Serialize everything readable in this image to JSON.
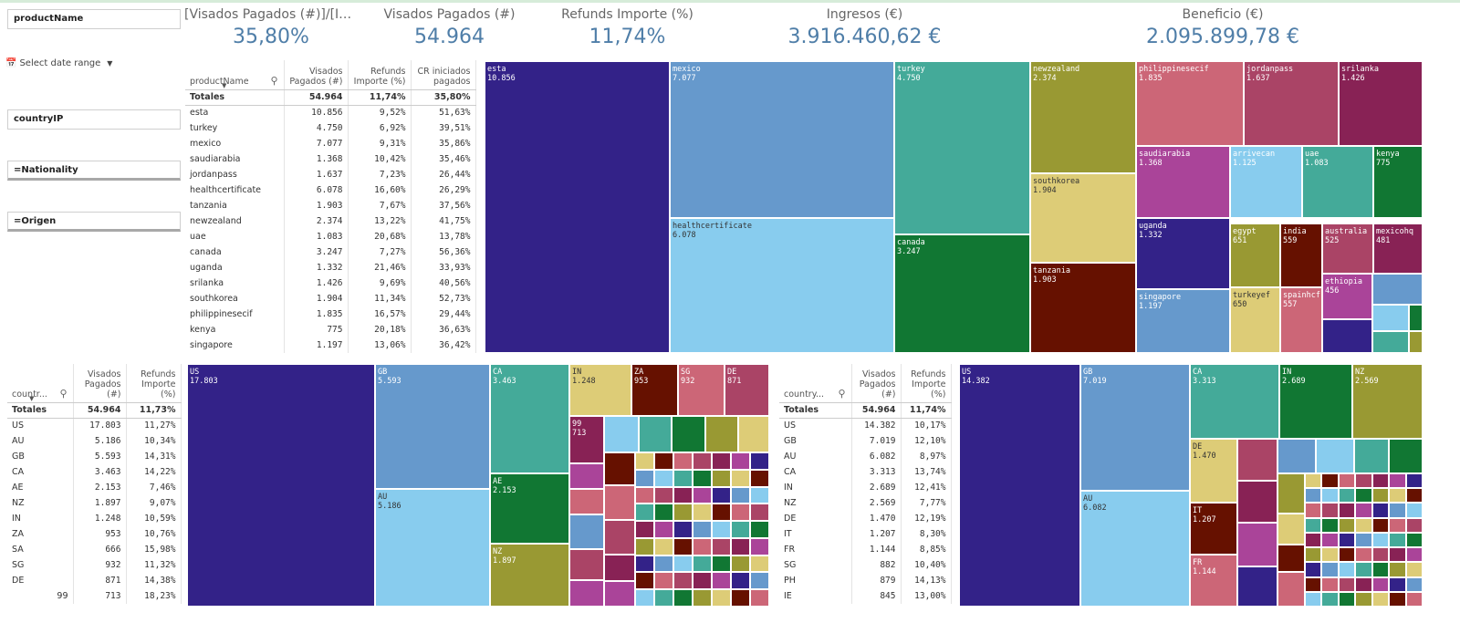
{
  "filters": {
    "product_name": "productName",
    "date_range": "Select date range",
    "country_ip": "countryIP",
    "nationality": "=Nationality",
    "origen": "=Origen"
  },
  "kpis": [
    {
      "label": "[Visados Pagados (#)]/[Iniciad...",
      "value": "35,80%"
    },
    {
      "label": "Visados Pagados (#)",
      "value": "54.964"
    },
    {
      "label": "Refunds Importe (%)",
      "value": "11,74%"
    },
    {
      "label": "Ingresos (€)",
      "value": "3.916.460,62 €"
    },
    {
      "label": "Beneficio (€)",
      "value": "2.095.899,78 €"
    }
  ],
  "product_table": {
    "headers": [
      "productName",
      "Visados Pagados (#)",
      "Refunds Importe (%)",
      "CR iniciados pagados"
    ],
    "totals": [
      "Totales",
      "54.964",
      "11,74%",
      "35,80%"
    ],
    "rows": [
      [
        "esta",
        "10.856",
        "9,52%",
        "51,63%"
      ],
      [
        "turkey",
        "4.750",
        "6,92%",
        "39,51%"
      ],
      [
        "mexico",
        "7.077",
        "9,31%",
        "35,86%"
      ],
      [
        "saudiarabia",
        "1.368",
        "10,42%",
        "35,46%"
      ],
      [
        "jordanpass",
        "1.637",
        "7,23%",
        "26,44%"
      ],
      [
        "healthcertificate",
        "6.078",
        "16,60%",
        "26,29%"
      ],
      [
        "tanzania",
        "1.903",
        "7,67%",
        "37,56%"
      ],
      [
        "newzealand",
        "2.374",
        "13,22%",
        "41,75%"
      ],
      [
        "uae",
        "1.083",
        "20,68%",
        "13,78%"
      ],
      [
        "canada",
        "3.247",
        "7,27%",
        "56,36%"
      ],
      [
        "uganda",
        "1.332",
        "21,46%",
        "33,93%"
      ],
      [
        "srilanka",
        "1.426",
        "9,69%",
        "40,56%"
      ],
      [
        "southkorea",
        "1.904",
        "11,34%",
        "52,73%"
      ],
      [
        "philippinesecif",
        "1.835",
        "16,57%",
        "29,44%"
      ],
      [
        "kenya",
        "775",
        "20,18%",
        "36,63%"
      ],
      [
        "singapore",
        "1.197",
        "13,06%",
        "36,42%"
      ]
    ]
  },
  "country_ip_table": {
    "headers": [
      "countr...",
      "Visados Pagados (#)",
      "Refunds Importe (%)"
    ],
    "totals": [
      "Totales",
      "54.964",
      "11,73%"
    ],
    "rows": [
      [
        "US",
        "17.803",
        "11,27%"
      ],
      [
        "AU",
        "5.186",
        "10,34%"
      ],
      [
        "GB",
        "5.593",
        "14,31%"
      ],
      [
        "CA",
        "3.463",
        "14,22%"
      ],
      [
        "AE",
        "2.153",
        "7,46%"
      ],
      [
        "NZ",
        "1.897",
        "9,07%"
      ],
      [
        "IN",
        "1.248",
        "10,59%"
      ],
      [
        "ZA",
        "953",
        "10,76%"
      ],
      [
        "SA",
        "666",
        "15,98%"
      ],
      [
        "SG",
        "932",
        "11,32%"
      ],
      [
        "DE",
        "871",
        "14,38%"
      ],
      [
        "99",
        "713",
        "18,23%"
      ]
    ]
  },
  "country_nat_table": {
    "headers": [
      "country...",
      "Visados Pagados (#)",
      "Refunds Importe (%)"
    ],
    "totals": [
      "Totales",
      "54.964",
      "11,74%"
    ],
    "rows": [
      [
        "US",
        "14.382",
        "10,17%"
      ],
      [
        "GB",
        "7.019",
        "12,10%"
      ],
      [
        "AU",
        "6.082",
        "8,97%"
      ],
      [
        "CA",
        "3.313",
        "13,74%"
      ],
      [
        "IN",
        "2.689",
        "12,41%"
      ],
      [
        "NZ",
        "2.569",
        "7,77%"
      ],
      [
        "DE",
        "1.470",
        "12,19%"
      ],
      [
        "IT",
        "1.207",
        "8,30%"
      ],
      [
        "FR",
        "1.144",
        "8,85%"
      ],
      [
        "SG",
        "882",
        "10,40%"
      ],
      [
        "PH",
        "879",
        "14,13%"
      ],
      [
        "IE",
        "845",
        "13,00%"
      ]
    ]
  },
  "colors": {
    "kpi_value": "#4f7ea8",
    "palette": [
      "#332288",
      "#6699cc",
      "#88ccee",
      "#44aa99",
      "#117733",
      "#999933",
      "#ddcc77",
      "#661100",
      "#cc6677",
      "#aa4466",
      "#882255",
      "#aa4499"
    ]
  },
  "treemap_products": [
    {
      "label": "esta",
      "value": "10.856"
    },
    {
      "label": "mexico",
      "value": "7.077"
    },
    {
      "label": "healthcertificate",
      "value": "6.078"
    },
    {
      "label": "turkey",
      "value": "4.750"
    },
    {
      "label": "canada",
      "value": "3.247"
    },
    {
      "label": "newzealand",
      "value": "2.374"
    },
    {
      "label": "southkorea",
      "value": "1.904"
    },
    {
      "label": "tanzania",
      "value": "1.903"
    },
    {
      "label": "philippinesecif",
      "value": "1.835"
    },
    {
      "label": "jordanpass",
      "value": "1.637"
    },
    {
      "label": "srilanka",
      "value": "1.426"
    },
    {
      "label": "saudiarabia",
      "value": "1.368"
    },
    {
      "label": "arrivecan",
      "value": "1.125"
    },
    {
      "label": "uae",
      "value": "1.083"
    },
    {
      "label": "kenya",
      "value": "775"
    },
    {
      "label": "uganda",
      "value": "1.332"
    },
    {
      "label": "egypt",
      "value": "651"
    },
    {
      "label": "india",
      "value": "559"
    },
    {
      "label": "australia",
      "value": "525"
    },
    {
      "label": "mexicohq",
      "value": "481"
    },
    {
      "label": "ethiopia",
      "value": "456"
    },
    {
      "label": "singapore",
      "value": "1.197"
    },
    {
      "label": "turkeyef",
      "value": "650"
    },
    {
      "label": "spainhcf",
      "value": "557"
    }
  ],
  "treemap_country_ip": [
    {
      "label": "US",
      "value": "17.803"
    },
    {
      "label": "GB",
      "value": "5.593"
    },
    {
      "label": "AU",
      "value": "5.186"
    },
    {
      "label": "CA",
      "value": "3.463"
    },
    {
      "label": "AE",
      "value": "2.153"
    },
    {
      "label": "NZ",
      "value": "1.897"
    },
    {
      "label": "IN",
      "value": "1.248"
    },
    {
      "label": "ZA",
      "value": "953"
    },
    {
      "label": "SG",
      "value": "932"
    },
    {
      "label": "DE",
      "value": "871"
    },
    {
      "label": "99",
      "value": "713"
    }
  ],
  "treemap_country_nat": [
    {
      "label": "US",
      "value": "14.382"
    },
    {
      "label": "GB",
      "value": "7.019"
    },
    {
      "label": "AU",
      "value": "6.082"
    },
    {
      "label": "CA",
      "value": "3.313"
    },
    {
      "label": "IN",
      "value": "2.689"
    },
    {
      "label": "NZ",
      "value": "2.569"
    },
    {
      "label": "DE",
      "value": "1.470"
    },
    {
      "label": "IT",
      "value": "1.207"
    },
    {
      "label": "FR",
      "value": "1.144"
    }
  ]
}
